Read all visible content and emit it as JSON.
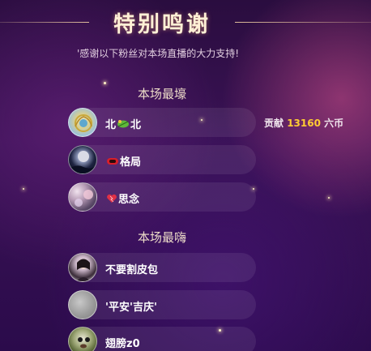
{
  "header": {
    "title": "特别鸣谢",
    "subtitle": "'感谢以下粉丝对本场直播的大力支持!"
  },
  "sections": [
    {
      "title": "本场最壕",
      "items": [
        {
          "name_left": "北",
          "name_right": "北",
          "badge": "green-leaf-icon"
        },
        {
          "name": "格局",
          "badge": "red-pill-icon"
        },
        {
          "name": "思念",
          "badge": "heart-icon"
        }
      ],
      "contribution": {
        "prefix": "贡献",
        "value": "13160",
        "unit": "六币"
      }
    },
    {
      "title": "本场最嗨",
      "items": [
        {
          "name": "不要割皮包"
        },
        {
          "name": "'平安'吉庆'"
        },
        {
          "name": "翅膀z0"
        }
      ]
    }
  ],
  "colors": {
    "accent": "#ffcc33",
    "title": "#fff0d6",
    "background": "#2a0d3f"
  }
}
